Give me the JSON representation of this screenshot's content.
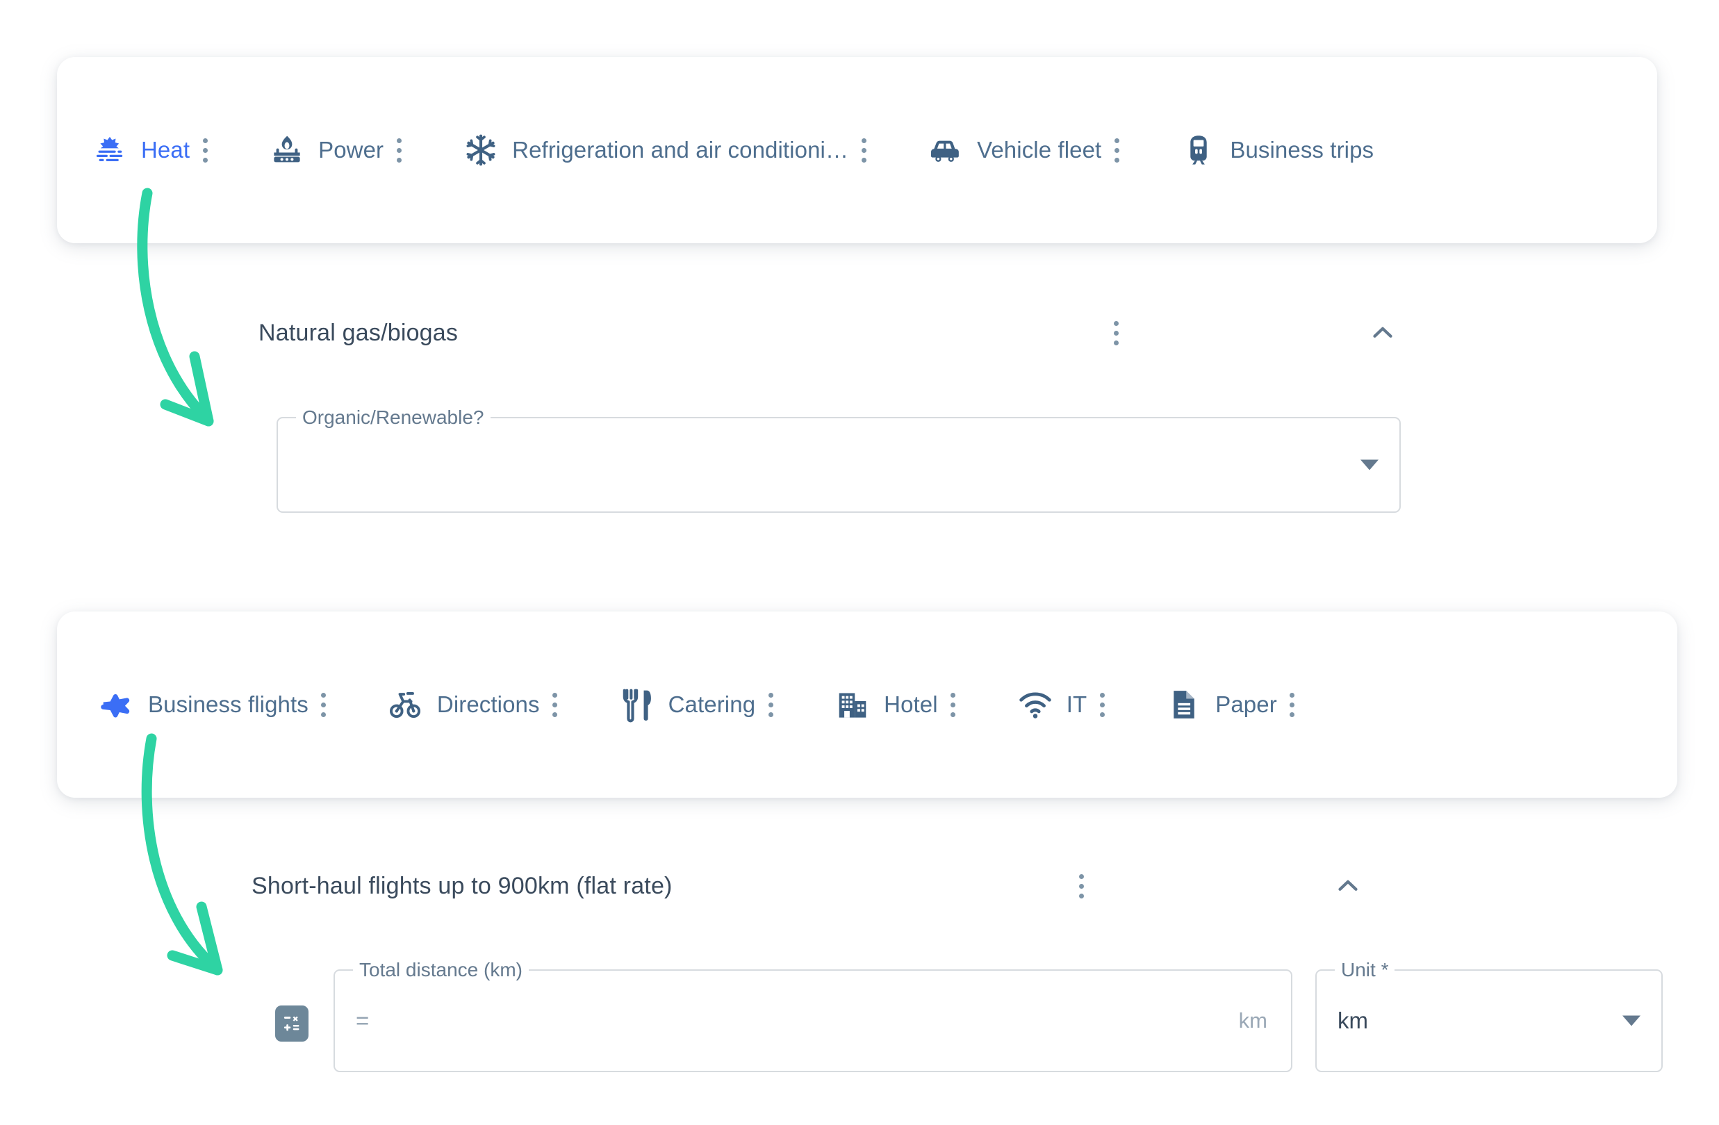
{
  "theme": {
    "accent_blue": "#3b6ef5",
    "tab_text": "#4e6e8e",
    "icon_slate": "#3f6183",
    "arrow_green": "#2ed3a3",
    "field_border": "#d7dbdf",
    "card_bg": "#ffffff",
    "page_bg": "#ffffff"
  },
  "heat_card": {
    "tabs": [
      {
        "label": "Heat",
        "icon": "sunrise-heat-icon",
        "active": true,
        "has_menu": true
      },
      {
        "label": "Power",
        "icon": "gas-burner-icon",
        "active": false,
        "has_menu": true
      },
      {
        "label": "Refrigeration and air conditioni…",
        "icon": "snowflake-icon",
        "active": false,
        "has_menu": true
      },
      {
        "label": "Vehicle fleet",
        "icon": "car-icon",
        "active": false,
        "has_menu": true
      },
      {
        "label": "Business trips",
        "icon": "train-icon",
        "active": false,
        "has_menu": false
      }
    ]
  },
  "heat_section": {
    "title": "Natural gas/biogas",
    "menu_icon": "kebab-menu-icon",
    "collapse_icon": "chevron-up-icon",
    "field": {
      "label": "Organic/Renewable?",
      "value": "",
      "caret_icon": "dropdown-caret-icon"
    }
  },
  "travel_card": {
    "tabs": [
      {
        "label": "Business flights",
        "icon": "airplane-icon",
        "active": true,
        "has_menu": true
      },
      {
        "label": "Directions",
        "icon": "bicycle-icon",
        "active": false,
        "has_menu": true
      },
      {
        "label": "Catering",
        "icon": "fork-knife-icon",
        "active": false,
        "has_menu": true
      },
      {
        "label": "Hotel",
        "icon": "building-icon",
        "active": false,
        "has_menu": true
      },
      {
        "label": "IT",
        "icon": "wifi-icon",
        "active": false,
        "has_menu": true
      },
      {
        "label": "Paper",
        "icon": "document-icon",
        "active": false,
        "has_menu": true
      }
    ]
  },
  "travel_section": {
    "title": "Short-haul flights up to 900km (flat rate)",
    "menu_icon": "kebab-menu-icon",
    "collapse_icon": "chevron-up-icon",
    "calculator_icon": "calculator-icon",
    "distance_field": {
      "label": "Total distance (km)",
      "value": "=",
      "suffix": "km"
    },
    "unit_field": {
      "label": "Unit *",
      "value": "km",
      "caret_icon": "dropdown-caret-icon"
    }
  },
  "annotations": [
    {
      "name": "arrow-to-organic-field",
      "icon": "curved-arrow-icon"
    },
    {
      "name": "arrow-to-distance-field",
      "icon": "curved-arrow-icon"
    }
  ]
}
